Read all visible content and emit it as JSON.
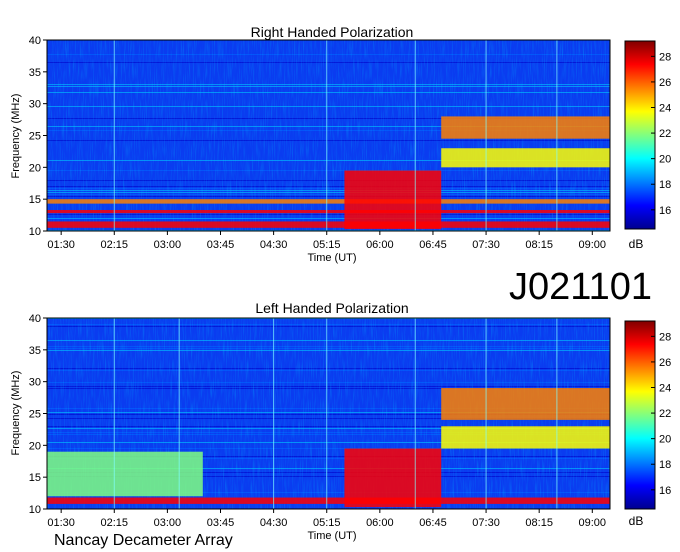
{
  "header": {
    "observation_id": "J021101",
    "instrument": "Nancay Decameter Array"
  },
  "chart_data": [
    {
      "type": "heatmap",
      "title": "Right Handed Polarization",
      "xlabel": "Time (UT)",
      "ylabel": "Frequency (MHz)",
      "x_ticks": [
        "01:30",
        "02:15",
        "03:00",
        "03:45",
        "04:30",
        "05:15",
        "06:00",
        "06:45",
        "07:30",
        "08:15",
        "09:00"
      ],
      "xlim": [
        "01:18",
        "09:15"
      ],
      "y_ticks": [
        10,
        15,
        20,
        25,
        30,
        35,
        40
      ],
      "ylim": [
        10,
        40
      ],
      "colorbar": {
        "label": "dB",
        "ticks": [
          16,
          18,
          20,
          22,
          24,
          26,
          28
        ],
        "range": [
          14.5,
          29.2
        ],
        "colormap": [
          "#00008f",
          "#0000ff",
          "#0080ff",
          "#00ffff",
          "#80ff80",
          "#ffff00",
          "#ff8000",
          "#ff0000",
          "#800000"
        ]
      },
      "bright_lines_time": [
        "02:15",
        "05:15",
        "06:30",
        "07:30",
        "08:30"
      ],
      "emission_regions": [
        {
          "t0": "01:18",
          "t1": "09:15",
          "f0": 10.5,
          "f1": 11.5,
          "db": 28
        },
        {
          "t0": "01:18",
          "t1": "09:15",
          "f0": 12.8,
          "f1": 13.3,
          "db": 27
        },
        {
          "t0": "01:18",
          "t1": "09:15",
          "f0": 14.3,
          "f1": 15.0,
          "db": 26
        },
        {
          "t0": "05:30",
          "t1": "06:52",
          "f0": 10.3,
          "f1": 19.5,
          "db": 28
        },
        {
          "t0": "06:52",
          "t1": "09:15",
          "f0": 24.5,
          "f1": 28.0,
          "db": 25
        },
        {
          "t0": "06:52",
          "t1": "09:15",
          "f0": 20.0,
          "f1": 23.0,
          "db": 24
        }
      ]
    },
    {
      "type": "heatmap",
      "title": "Left Handed Polarization",
      "xlabel": "Time (UT)",
      "ylabel": "Frequency (MHz)",
      "x_ticks": [
        "01:30",
        "02:15",
        "03:00",
        "03:45",
        "04:30",
        "05:15",
        "06:00",
        "06:45",
        "07:30",
        "08:15",
        "09:00"
      ],
      "xlim": [
        "01:18",
        "09:15"
      ],
      "y_ticks": [
        10,
        15,
        20,
        25,
        30,
        35,
        40
      ],
      "ylim": [
        10,
        40
      ],
      "colorbar": {
        "label": "dB",
        "ticks": [
          16,
          18,
          20,
          22,
          24,
          26,
          28
        ],
        "range": [
          14.5,
          29.2
        ],
        "colormap": [
          "#00008f",
          "#0000ff",
          "#0080ff",
          "#00ffff",
          "#80ff80",
          "#ffff00",
          "#ff8000",
          "#ff0000",
          "#800000"
        ]
      },
      "bright_lines_time": [
        "02:15",
        "03:10",
        "04:30",
        "05:15",
        "06:30",
        "07:30",
        "08:30"
      ],
      "emission_regions": [
        {
          "t0": "01:18",
          "t1": "09:15",
          "f0": 10.8,
          "f1": 11.8,
          "db": 28
        },
        {
          "t0": "01:18",
          "t1": "03:30",
          "f0": 12.0,
          "f1": 19.0,
          "db": 21
        },
        {
          "t0": "05:30",
          "t1": "06:52",
          "f0": 10.3,
          "f1": 19.5,
          "db": 28
        },
        {
          "t0": "06:52",
          "t1": "09:15",
          "f0": 24.0,
          "f1": 29.0,
          "db": 25
        },
        {
          "t0": "06:52",
          "t1": "09:15",
          "f0": 19.5,
          "f1": 23.0,
          "db": 24
        }
      ]
    }
  ]
}
